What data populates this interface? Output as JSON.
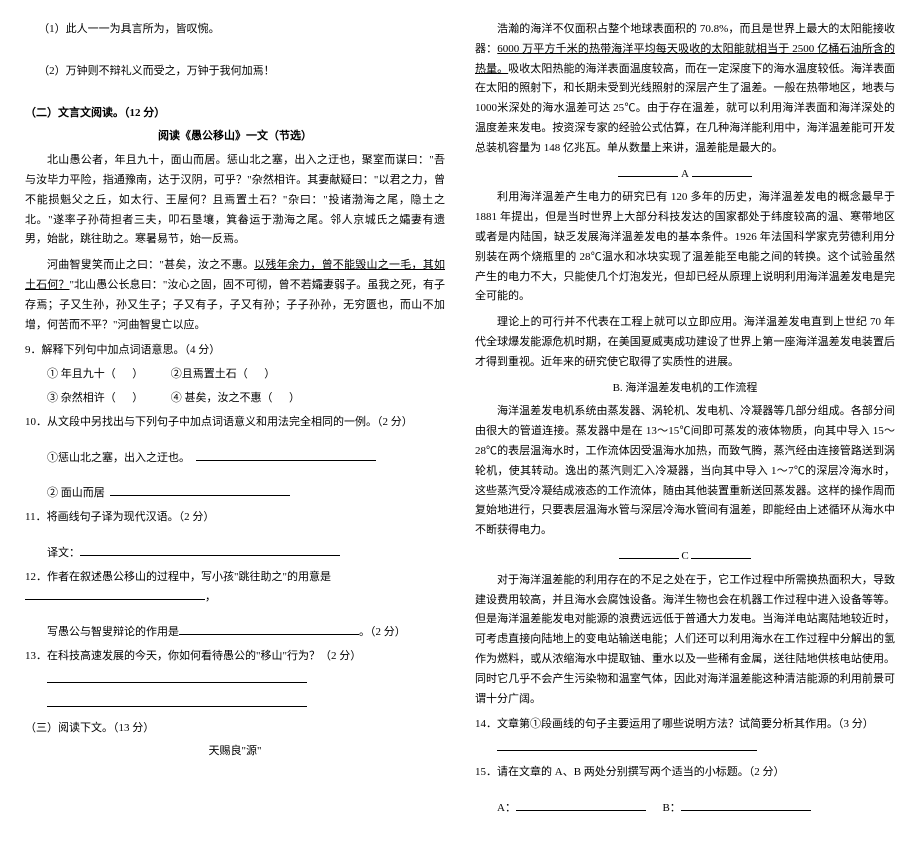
{
  "left": {
    "q1_1": "（1）此人一一为具言所为，皆叹惋。",
    "q1_2": "（2）万钟则不辩礼义而受之，万钟于我何加焉！",
    "section2_title": "（二）文言文阅读。（12 分）",
    "section2_sub": "阅读《愚公移山》一文（节选）",
    "passage1": "北山愚公者，年且九十，面山而居。惩山北之塞，出入之迂也，聚室而谋曰：\"吾与汝毕力平险，指通豫南，达于汉阴，可乎？\"杂然相许。其妻献疑曰：\"以君之力，曾不能损魁父之丘，如太行、王屋何？且焉置土石？\"杂曰：\"投诸渤海之尾，隐土之北。\"遂率子孙荷担者三夫，叩石垦壤，箕畚运于渤海之尾。邻人京城氏之孀妻有遗男，始龀，跳往助之。寒暑易节，始一反焉。",
    "passage2_a": "河曲智叟笑而止之曰：\"甚矣，汝之不惠。",
    "passage2_u": "以残年余力，曾不能毁山之一毛，其如土石何？",
    "passage2_b": "\"北山愚公长息曰：\"汝心之固，固不可彻，曾不若孀妻弱子。虽我之死，有子存焉；子又生孙，孙又生子；子又有子，子又有孙；子子孙孙，无穷匮也，而山不加增，何苦而不平？\"河曲智叟亡以应。",
    "q9": "9．解释下列句中加点词语意思。（4 分）",
    "q9_1a": "① 年且九十（",
    "q9_1b": "）",
    "q9_2a": "②且焉置土石（",
    "q9_2b": "）",
    "q9_3a": "③ 杂然相许（",
    "q9_3b": "）",
    "q9_4a": "④ 甚矣，汝之不惠（",
    "q9_4b": "）",
    "q10": "10．从文段中另找出与下列句子中加点词语意义和用法完全相同的一例。（2 分）",
    "q10_1": "①惩山北之塞，出入之迂也。",
    "q10_2": "② 面山而居",
    "q11": "11．将画线句子译为现代汉语。（2 分）",
    "q11_label": "译文：",
    "q12": "12．作者在叙述愚公移山的过程中，写小孩\"跳往助之\"的用意是",
    "q12b": "写愚公与智叟辩论的作用是",
    "q12pts": "。（2 分）",
    "q13": "13．在科技高速发展的今天，你如何看待愚公的\"移山\"行为？（2 分）",
    "section3_title": "（三）阅读下文。（13 分）",
    "section3_sub": "天赐良\"源\""
  },
  "right": {
    "p1a": "浩瀚的海洋不仅面积占整个地球表面积的 70.8%，而且是世界上最大的太阳能接收器：",
    "p1u": "6000 万平方千米的热带海洋平均每天吸收的太阳能就相当于 2500 亿桶石油所含的热量。",
    "p1b": "吸收太阳热能的海洋表面温度较高，而在一定深度下的海水温度较低。海洋表面在太阳的照射下，和长期未受到光线照射的深层产生了温差。一般在热带地区，地表与 1000米深处的海水温差可达 25℃。由于存在温差，就可以利用海洋表面和海洋深处的温度差来发电。按资深专家的经验公式估算，在几种海洋能利用中，海洋温差能可开发总装机容量为 148 亿兆瓦。单从数量上来讲，温差能是最大的。",
    "letterA": "A",
    "p2": "利用海洋温差产生电力的研究已有 120 多年的历史，海洋温差发电的概念最早于1881 年提出，但是当时世界上大部分科技发达的国家都处于纬度较高的温、寒带地区或者是内陆国，缺乏发展海洋温差发电的基本条件。1926 年法国科学家克劳德利用分别装在两个烧瓶里的 28℃温水和冰块实现了温差能至电能之间的转换。这个试验虽然产生的电力不大，只能使几个灯泡发光，但却已经从原理上说明利用海洋温差发电是完全可能的。",
    "p3": "理论上的可行并不代表在工程上就可以立即应用。海洋温差发电直到上世纪 70 年代全球爆发能源危机时期，在美国夏威夷成功建设了世界上第一座海洋温差发电装置后才得到重视。近年来的研究使它取得了实质性的进展。",
    "letterB": "B. 海洋温差发电机的工作流程",
    "p4": "海洋温差发电机系统由蒸发器、涡轮机、发电机、冷凝器等几部分组成。各部分间由很大的管道连接。蒸发器中是在 13～15℃间即可蒸发的液体物质，向其中导入 15～28℃的表层温海水时，工作流体因受温海水加热，而致气腾，蒸汽经由连接管路送到涡轮机，使其转动。逸出的蒸汽则汇入冷凝器，当向其中导入 1～7℃的深层冷海水时，这些蒸汽受冷凝结成液态的工作流体，随由其他装置重新送回蒸发器。这样的操作周而复始地进行，只要表层温海水管与深层冷海水管间有温差，即能经由上述循环从海水中不断获得电力。",
    "letterC": "C",
    "p5": "对于海洋温差能的利用存在的不足之处在于，它工作过程中所需换热面积大，导致建设费用较高，并且海水会腐蚀设备。海洋生物也会在机器工作过程中进入设备等等。但是海洋温差能发电对能源的浪费远远低于普通大力发电。当海洋电站离陆地较近时，可考虑直接向陆地上的变电站输送电能；人们还可以利用海水在工作过程中分解出的氢作为燃料，或从浓缩海水中提取铀、重水以及一些稀有金属，送往陆地供核电站使用。同时它几乎不会产生污染物和温室气体，因此对海洋温差能这种清洁能源的利用前景可谓十分广阔。",
    "q14": "14．文章第①段画线的句子主要运用了哪些说明方法？试简要分析其作用。（3 分）",
    "q15": "15．请在文章的 A、B 两处分别撰写两个适当的小标题。（2 分）",
    "lblA": "A：",
    "lblB": "B："
  }
}
